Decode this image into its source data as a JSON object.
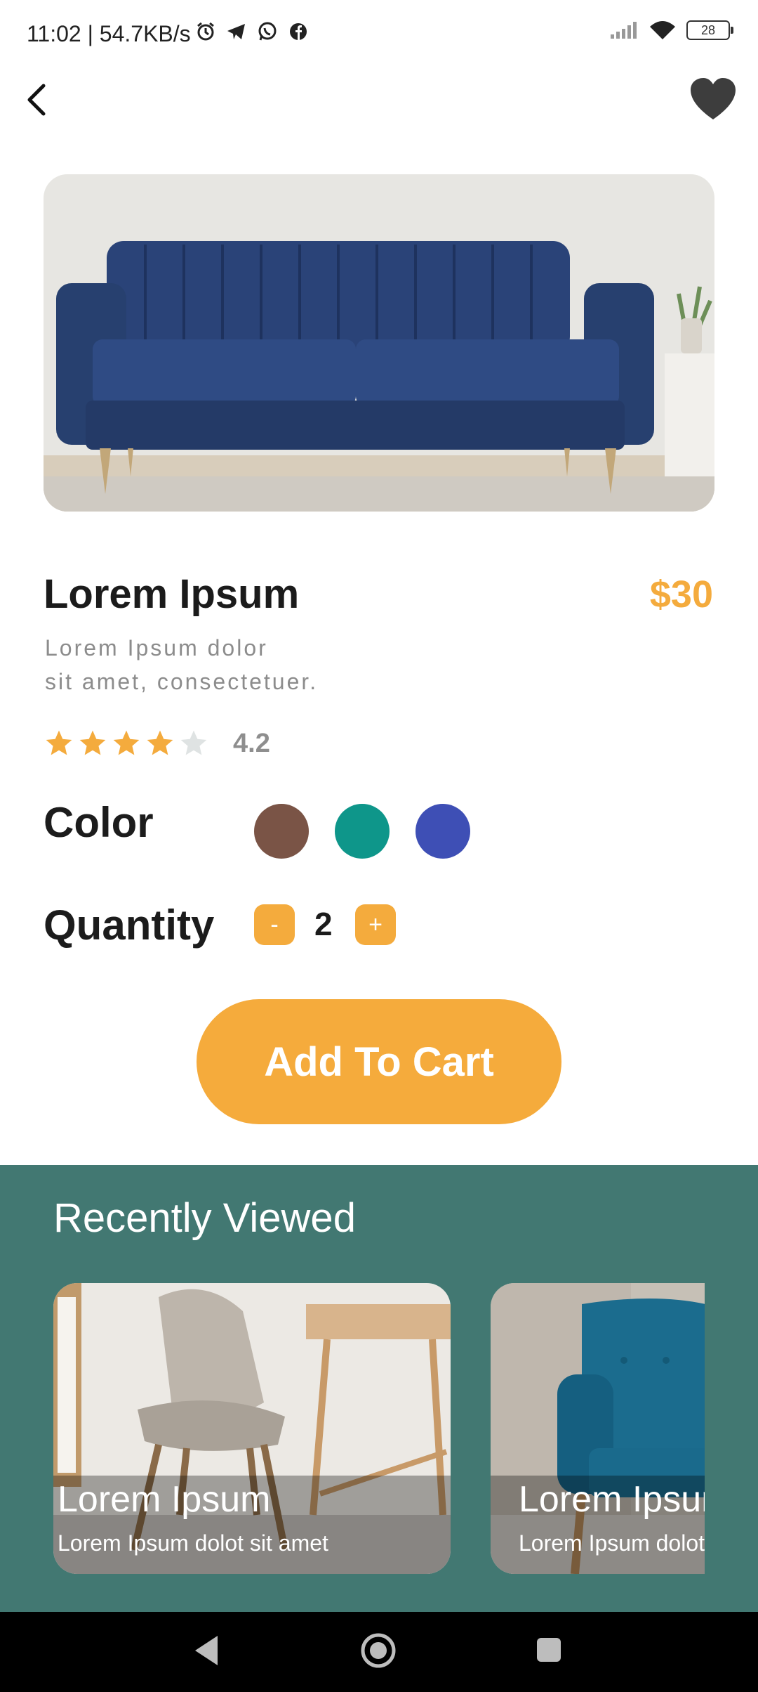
{
  "status_bar": {
    "time": "11:02 | 54.7KB/s",
    "icons": [
      "alarm-icon",
      "telegram-icon",
      "whatsapp-icon",
      "facebook-icon",
      "signal-icon",
      "wifi-icon",
      "battery-icon"
    ],
    "battery": "28"
  },
  "top_nav": {
    "back_icon": "back-arrow-icon",
    "favorite_icon": "heart-icon"
  },
  "product": {
    "title": "Lorem Ipsum",
    "price": "$30",
    "description_line1": "Lorem Ipsum dolor",
    "description_line2": "sit amet, consectetuer.",
    "rating_value": "4.2",
    "rating_stars": 4.2,
    "star_color": "#f4ab3d",
    "empty_star_color": "#dfe3e3"
  },
  "color_section": {
    "label": "Color",
    "swatches": [
      "#7a5446",
      "#0e968a",
      "#3e4fb5"
    ]
  },
  "quantity_section": {
    "label": "Quantity",
    "minus": "-",
    "value": "2",
    "plus": "+"
  },
  "cart_button": {
    "label": "Add To Cart",
    "color": "#f5ab3c"
  },
  "recent": {
    "title": "Recently Viewed",
    "background": "#427872",
    "cards": [
      {
        "title": "Lorem Ipsum",
        "subtitle": "Lorem Ipsum dolot sit amet"
      },
      {
        "title": "Lorem Ipsum",
        "subtitle": "Lorem Ipsum dolot sit amet"
      }
    ]
  },
  "nav_bar": {
    "icons": [
      "back-triangle-icon",
      "home-circle-icon",
      "recents-square-icon"
    ]
  }
}
